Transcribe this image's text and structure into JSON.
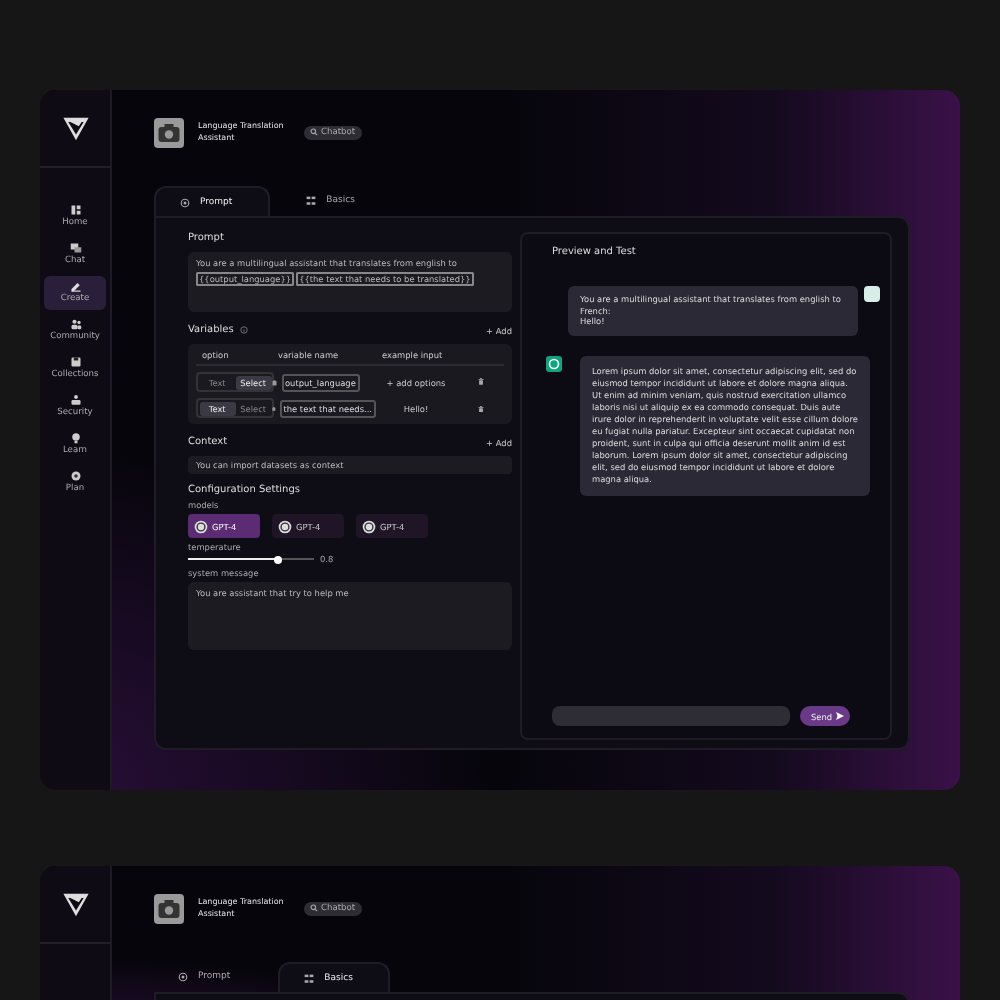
{
  "screens": [
    {
      "sidebar": {
        "items": [
          {
            "label": "Home",
            "selected": false
          },
          {
            "label": "Chat",
            "selected": false
          },
          {
            "label": "Create",
            "selected": true
          },
          {
            "label": "Community",
            "selected": false
          },
          {
            "label": "Collections",
            "selected": false
          },
          {
            "label": "Security",
            "selected": false
          },
          {
            "label": "Learn",
            "selected": false
          },
          {
            "label": "Plan",
            "selected": false
          }
        ]
      },
      "header": {
        "title": "Language Translation Assistant",
        "badge": "Chatbot"
      },
      "tabs": [
        {
          "label": "Prompt",
          "selected": true
        },
        {
          "label": "Basics",
          "selected": false
        }
      ],
      "prompt": {
        "heading": "Prompt",
        "text": "You are a multilingual assistant that translates from english to",
        "chips": [
          "{{output_language}}",
          "{{the text that needs to be translated}}"
        ]
      },
      "variables": {
        "heading": "Variables",
        "add": "+ Add",
        "columns": [
          "option",
          "variable name",
          "example input"
        ],
        "rows": [
          {
            "options": [
              {
                "label": "Text",
                "selected": false
              },
              {
                "label": "Select",
                "selected": true
              }
            ],
            "name": "output_language",
            "example": "+ add options"
          },
          {
            "options": [
              {
                "label": "Text",
                "selected": true
              },
              {
                "label": "Select",
                "selected": false
              }
            ],
            "name": "the text that needs...",
            "example": "Hello!"
          }
        ]
      },
      "context": {
        "heading": "Context",
        "add": "+ Add",
        "placeholder": "You can import datasets as context"
      },
      "config": {
        "heading": "Configuration Settings",
        "models_label": "models",
        "models": [
          {
            "label": "GPT-4",
            "selected": true
          },
          {
            "label": "GPT-4",
            "selected": false
          },
          {
            "label": "GPT-4",
            "selected": false
          }
        ],
        "temperature": {
          "label": "temperature",
          "level": 0.72,
          "reading": "0.8"
        },
        "system": {
          "label": "system message",
          "value": "You are assistant that try to help me"
        }
      },
      "preview": {
        "heading": "Preview and Test",
        "user_lines": [
          "You are a multilingual assistant that translates from english to French:",
          "Hello!"
        ],
        "bot": "Lorem ipsum dolor sit amet, consectetur adipiscing elit, sed do eiusmod tempor incididunt ut labore et dolore magna aliqua. Ut enim ad minim veniam, quis nostrud exercitation ullamco laboris nisi ut aliquip ex ea commodo consequat. Duis aute irure dolor in reprehenderit in voluptate velit esse cillum dolore eu fugiat nulla pariatur. Excepteur sint occaecat cupidatat non proident, sunt in culpa qui officia deserunt mollit anim id est laborum. Lorem ipsum dolor sit amet, consectetur adipiscing elit, sed do eiusmod tempor incididunt ut labore et dolore magna aliqua.",
        "send": "Send"
      }
    },
    {
      "header": {
        "title": "Language Translation Assistant",
        "badge": "Chatbot"
      },
      "tabs": [
        {
          "label": "Prompt",
          "selected": false
        },
        {
          "label": "Basics",
          "selected": true
        }
      ]
    }
  ]
}
